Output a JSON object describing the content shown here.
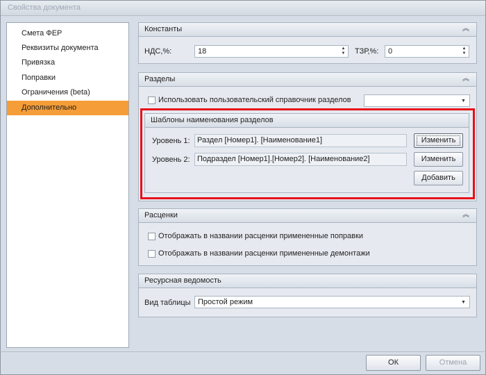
{
  "window": {
    "title": "Свойства документа"
  },
  "nav": {
    "items": [
      {
        "label": "Смета ФЕР",
        "selected": false
      },
      {
        "label": "Реквизиты документа",
        "selected": false
      },
      {
        "label": "Привязка",
        "selected": false
      },
      {
        "label": "Поправки",
        "selected": false
      },
      {
        "label": "Ограничения (beta)",
        "selected": false
      },
      {
        "label": "Дополнительно",
        "selected": true
      }
    ]
  },
  "constants": {
    "title": "Константы",
    "nds_label": "НДС,%:",
    "nds_value": "18",
    "tzr_label": "ТЗР,%:",
    "tzr_value": "0"
  },
  "sections": {
    "title": "Разделы",
    "custom_ref_label": "Использовать пользовательский справочник разделов",
    "custom_ref_checked": false,
    "custom_ref_value": "",
    "templates": {
      "title": "Шаблоны наименования разделов",
      "level1_label": "Уровень 1:",
      "level1_value": "Раздел [Номер1]. [Наименование1]",
      "level2_label": "Уровень 2:",
      "level2_value": "Подраздел [Номер1].[Номер2]. [Наименование2]",
      "edit_label": "Изменить",
      "add_label": "Добавить"
    }
  },
  "rates": {
    "title": "Расценки",
    "show_corrections_label": "Отображать в названии расценки примененные поправки",
    "show_corrections_checked": false,
    "show_dismantling_label": "Отображать в названии расценки примененные демонтажи",
    "show_dismantling_checked": false
  },
  "resources": {
    "title": "Ресурсная ведомость",
    "view_label": "Вид таблицы",
    "view_value": "Простой режим"
  },
  "footer": {
    "ok_label": "ОК",
    "cancel_label": "Отмена"
  },
  "colors": {
    "selected_nav": "#f59d38",
    "highlight_frame": "#e8101a"
  },
  "icons": {
    "collapse": "double-chevron-up-icon",
    "spin": "spin-arrows-icon",
    "dropdown": "chevron-down-icon"
  }
}
